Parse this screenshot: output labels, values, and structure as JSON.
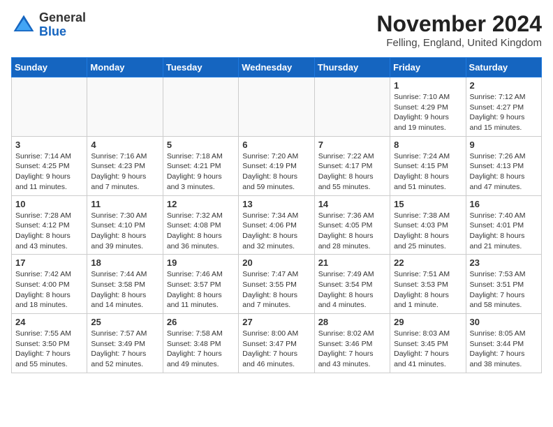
{
  "header": {
    "logo_line1": "General",
    "logo_line2": "Blue",
    "month_title": "November 2024",
    "location": "Felling, England, United Kingdom"
  },
  "weekdays": [
    "Sunday",
    "Monday",
    "Tuesday",
    "Wednesday",
    "Thursday",
    "Friday",
    "Saturday"
  ],
  "weeks": [
    [
      {
        "day": "",
        "info": ""
      },
      {
        "day": "",
        "info": ""
      },
      {
        "day": "",
        "info": ""
      },
      {
        "day": "",
        "info": ""
      },
      {
        "day": "",
        "info": ""
      },
      {
        "day": "1",
        "info": "Sunrise: 7:10 AM\nSunset: 4:29 PM\nDaylight: 9 hours and 19 minutes."
      },
      {
        "day": "2",
        "info": "Sunrise: 7:12 AM\nSunset: 4:27 PM\nDaylight: 9 hours and 15 minutes."
      }
    ],
    [
      {
        "day": "3",
        "info": "Sunrise: 7:14 AM\nSunset: 4:25 PM\nDaylight: 9 hours and 11 minutes."
      },
      {
        "day": "4",
        "info": "Sunrise: 7:16 AM\nSunset: 4:23 PM\nDaylight: 9 hours and 7 minutes."
      },
      {
        "day": "5",
        "info": "Sunrise: 7:18 AM\nSunset: 4:21 PM\nDaylight: 9 hours and 3 minutes."
      },
      {
        "day": "6",
        "info": "Sunrise: 7:20 AM\nSunset: 4:19 PM\nDaylight: 8 hours and 59 minutes."
      },
      {
        "day": "7",
        "info": "Sunrise: 7:22 AM\nSunset: 4:17 PM\nDaylight: 8 hours and 55 minutes."
      },
      {
        "day": "8",
        "info": "Sunrise: 7:24 AM\nSunset: 4:15 PM\nDaylight: 8 hours and 51 minutes."
      },
      {
        "day": "9",
        "info": "Sunrise: 7:26 AM\nSunset: 4:13 PM\nDaylight: 8 hours and 47 minutes."
      }
    ],
    [
      {
        "day": "10",
        "info": "Sunrise: 7:28 AM\nSunset: 4:12 PM\nDaylight: 8 hours and 43 minutes."
      },
      {
        "day": "11",
        "info": "Sunrise: 7:30 AM\nSunset: 4:10 PM\nDaylight: 8 hours and 39 minutes."
      },
      {
        "day": "12",
        "info": "Sunrise: 7:32 AM\nSunset: 4:08 PM\nDaylight: 8 hours and 36 minutes."
      },
      {
        "day": "13",
        "info": "Sunrise: 7:34 AM\nSunset: 4:06 PM\nDaylight: 8 hours and 32 minutes."
      },
      {
        "day": "14",
        "info": "Sunrise: 7:36 AM\nSunset: 4:05 PM\nDaylight: 8 hours and 28 minutes."
      },
      {
        "day": "15",
        "info": "Sunrise: 7:38 AM\nSunset: 4:03 PM\nDaylight: 8 hours and 25 minutes."
      },
      {
        "day": "16",
        "info": "Sunrise: 7:40 AM\nSunset: 4:01 PM\nDaylight: 8 hours and 21 minutes."
      }
    ],
    [
      {
        "day": "17",
        "info": "Sunrise: 7:42 AM\nSunset: 4:00 PM\nDaylight: 8 hours and 18 minutes."
      },
      {
        "day": "18",
        "info": "Sunrise: 7:44 AM\nSunset: 3:58 PM\nDaylight: 8 hours and 14 minutes."
      },
      {
        "day": "19",
        "info": "Sunrise: 7:46 AM\nSunset: 3:57 PM\nDaylight: 8 hours and 11 minutes."
      },
      {
        "day": "20",
        "info": "Sunrise: 7:47 AM\nSunset: 3:55 PM\nDaylight: 8 hours and 7 minutes."
      },
      {
        "day": "21",
        "info": "Sunrise: 7:49 AM\nSunset: 3:54 PM\nDaylight: 8 hours and 4 minutes."
      },
      {
        "day": "22",
        "info": "Sunrise: 7:51 AM\nSunset: 3:53 PM\nDaylight: 8 hours and 1 minute."
      },
      {
        "day": "23",
        "info": "Sunrise: 7:53 AM\nSunset: 3:51 PM\nDaylight: 7 hours and 58 minutes."
      }
    ],
    [
      {
        "day": "24",
        "info": "Sunrise: 7:55 AM\nSunset: 3:50 PM\nDaylight: 7 hours and 55 minutes."
      },
      {
        "day": "25",
        "info": "Sunrise: 7:57 AM\nSunset: 3:49 PM\nDaylight: 7 hours and 52 minutes."
      },
      {
        "day": "26",
        "info": "Sunrise: 7:58 AM\nSunset: 3:48 PM\nDaylight: 7 hours and 49 minutes."
      },
      {
        "day": "27",
        "info": "Sunrise: 8:00 AM\nSunset: 3:47 PM\nDaylight: 7 hours and 46 minutes."
      },
      {
        "day": "28",
        "info": "Sunrise: 8:02 AM\nSunset: 3:46 PM\nDaylight: 7 hours and 43 minutes."
      },
      {
        "day": "29",
        "info": "Sunrise: 8:03 AM\nSunset: 3:45 PM\nDaylight: 7 hours and 41 minutes."
      },
      {
        "day": "30",
        "info": "Sunrise: 8:05 AM\nSunset: 3:44 PM\nDaylight: 7 hours and 38 minutes."
      }
    ]
  ]
}
